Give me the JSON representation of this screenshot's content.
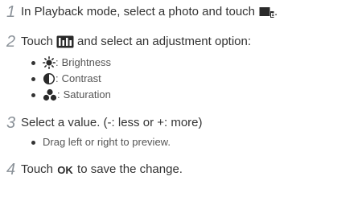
{
  "steps": [
    {
      "number": "1",
      "text_before": "In Playback mode, select a photo and touch",
      "icon": "edit-photo-icon",
      "text_after": "."
    },
    {
      "number": "2",
      "text_before": "Touch",
      "icon": "adjust-menu-icon",
      "text_after": "and select an adjustment option:",
      "options": [
        {
          "icon": "brightness-icon",
          "label": "Brightness"
        },
        {
          "icon": "contrast-icon",
          "label": "Contrast"
        },
        {
          "icon": "saturation-icon",
          "label": "Saturation"
        }
      ]
    },
    {
      "number": "3",
      "text": "Select a value. (-: less or +: more)",
      "bullets": [
        "Drag left or right to preview."
      ]
    },
    {
      "number": "4",
      "text_before": "Touch",
      "icon": "ok-icon",
      "icon_text": "OK",
      "text_after": "to save the change."
    }
  ],
  "colors": {
    "step_number": "#8b9299",
    "body_text": "#333333",
    "sub_text": "#555555"
  }
}
